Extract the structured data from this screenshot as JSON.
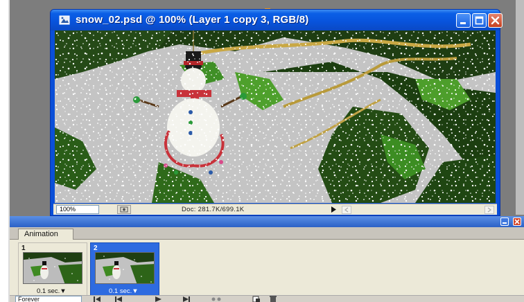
{
  "document_window": {
    "title": "snow_02.psd @ 100% (Layer 1 copy 3, RGB/8)",
    "icon": "photoshop-document-icon",
    "controls": [
      "minimize-icon",
      "maximize-icon",
      "close-icon"
    ],
    "accent_color": "#0a4fd8",
    "status": {
      "zoom": "100%",
      "doc_size": "Doc: 281.7K/699.1K"
    }
  },
  "animation_palette": {
    "tab_label": "Animation",
    "frames": [
      {
        "number": "1",
        "delay": "0.1 sec.▼",
        "selected": false
      },
      {
        "number": "2",
        "delay": "0.1 sec.▼",
        "selected": true
      }
    ],
    "loop_option": "Forever",
    "controls": [
      "first-frame-icon",
      "previous-frame-icon",
      "play-icon",
      "next-frame-icon",
      "tween-icon",
      "new-frame-icon",
      "delete-frame-icon"
    ],
    "selection_color": "#2e6be0"
  }
}
